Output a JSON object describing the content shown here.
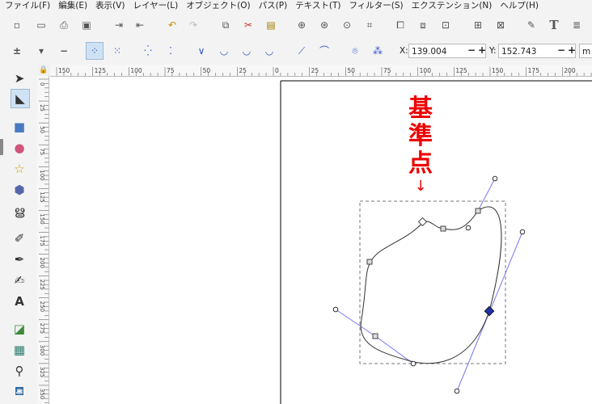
{
  "menu": {
    "items": [
      "ファイル(F)",
      "編集(E)",
      "表示(V)",
      "レイヤー(L)",
      "オブジェクト(O)",
      "パス(P)",
      "テキスト(T)",
      "フィルター(S)",
      "エクステンション(N)",
      "ヘルプ(H)"
    ]
  },
  "coords": {
    "x_label": "X:",
    "x_value": "139.004",
    "y_label": "Y:",
    "y_value": "152.743",
    "minus": "−",
    "plus": "+",
    "unit_cut": "m"
  },
  "ruler": {
    "h_labels": [
      "150",
      "125",
      "100",
      "75",
      "50",
      "25",
      "0",
      "25",
      "50",
      "75",
      "100",
      "125",
      "150",
      "175",
      "200"
    ],
    "v_labels": [
      "0",
      "25",
      "50",
      "75",
      "100",
      "125",
      "150",
      "175",
      "200",
      "225",
      "250",
      "275",
      "300",
      "325",
      "350"
    ]
  },
  "annotation": {
    "text_line1": "基",
    "text_line2": "準",
    "text_line3": "点",
    "arrow": "↓"
  },
  "colors": {
    "annotation": "#ee0000",
    "handle_line": "#7777ee",
    "selected_node": "#2233aa"
  },
  "icons": {
    "toolbox": [
      "selector-arrow-icon",
      "node-edit-icon",
      "rectangle-icon",
      "ellipse-icon",
      "star-icon",
      "3d-box-icon",
      "spiral-icon",
      "pencil-icon",
      "pen-icon",
      "calligraphy-icon",
      "text-icon",
      "gradient-icon",
      "mesh-icon",
      "dropper-icon",
      "paint-bucket-icon"
    ]
  }
}
